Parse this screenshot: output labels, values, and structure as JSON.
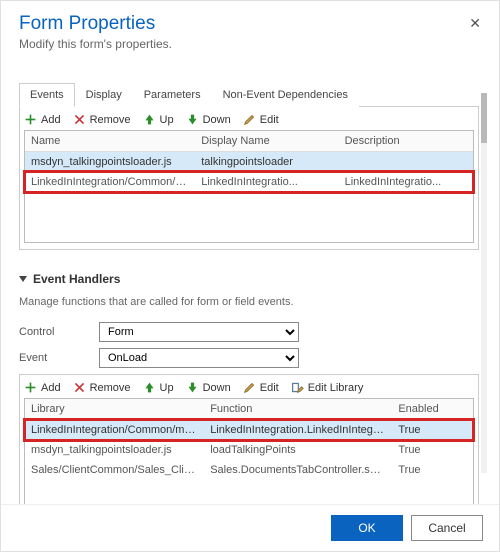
{
  "header": {
    "title": "Form Properties",
    "subtitle": "Modify this form's properties.",
    "close": "✕"
  },
  "tabs": {
    "events": "Events",
    "display": "Display",
    "parameters": "Parameters",
    "nonEvent": "Non-Event Dependencies"
  },
  "libToolbar": {
    "add": "Add",
    "remove": "Remove",
    "up": "Up",
    "down": "Down",
    "edit": "Edit"
  },
  "libGrid": {
    "cols": {
      "name": "Name",
      "display": "Display Name",
      "desc": "Description"
    },
    "rows": [
      {
        "name": "msdyn_talkingpointsloader.js",
        "display": "talkingpointsloader",
        "desc": ""
      },
      {
        "name": "LinkedInIntegration/Common/msdyn_L...",
        "display": "LinkedInIntegratio...",
        "desc": "LinkedInIntegratio..."
      }
    ]
  },
  "handlers": {
    "title": "Event Handlers",
    "desc": "Manage functions that are called for form or field events.",
    "controlLabel": "Control",
    "controlValue": "Form",
    "eventLabel": "Event",
    "eventValue": "OnLoad"
  },
  "handlerToolbar": {
    "add": "Add",
    "remove": "Remove",
    "up": "Up",
    "down": "Down",
    "edit": "Edit",
    "editLibrary": "Edit Library"
  },
  "handlerGrid": {
    "cols": {
      "lib": "Library",
      "func": "Function",
      "enabled": "Enabled"
    },
    "rows": [
      {
        "lib": "LinkedInIntegration/Common/msdyn_L...",
        "func": "LinkedInIntegration.LinkedInIntegration...",
        "enabled": "True"
      },
      {
        "lib": "msdyn_talkingpointsloader.js",
        "func": "loadTalkingPoints",
        "enabled": "True"
      },
      {
        "lib": "Sales/ClientCommon/Sales_ClientCom...",
        "func": "Sales.DocumentsTabController.shouldS...",
        "enabled": "True"
      }
    ]
  },
  "footer": {
    "ok": "OK",
    "cancel": "Cancel"
  }
}
